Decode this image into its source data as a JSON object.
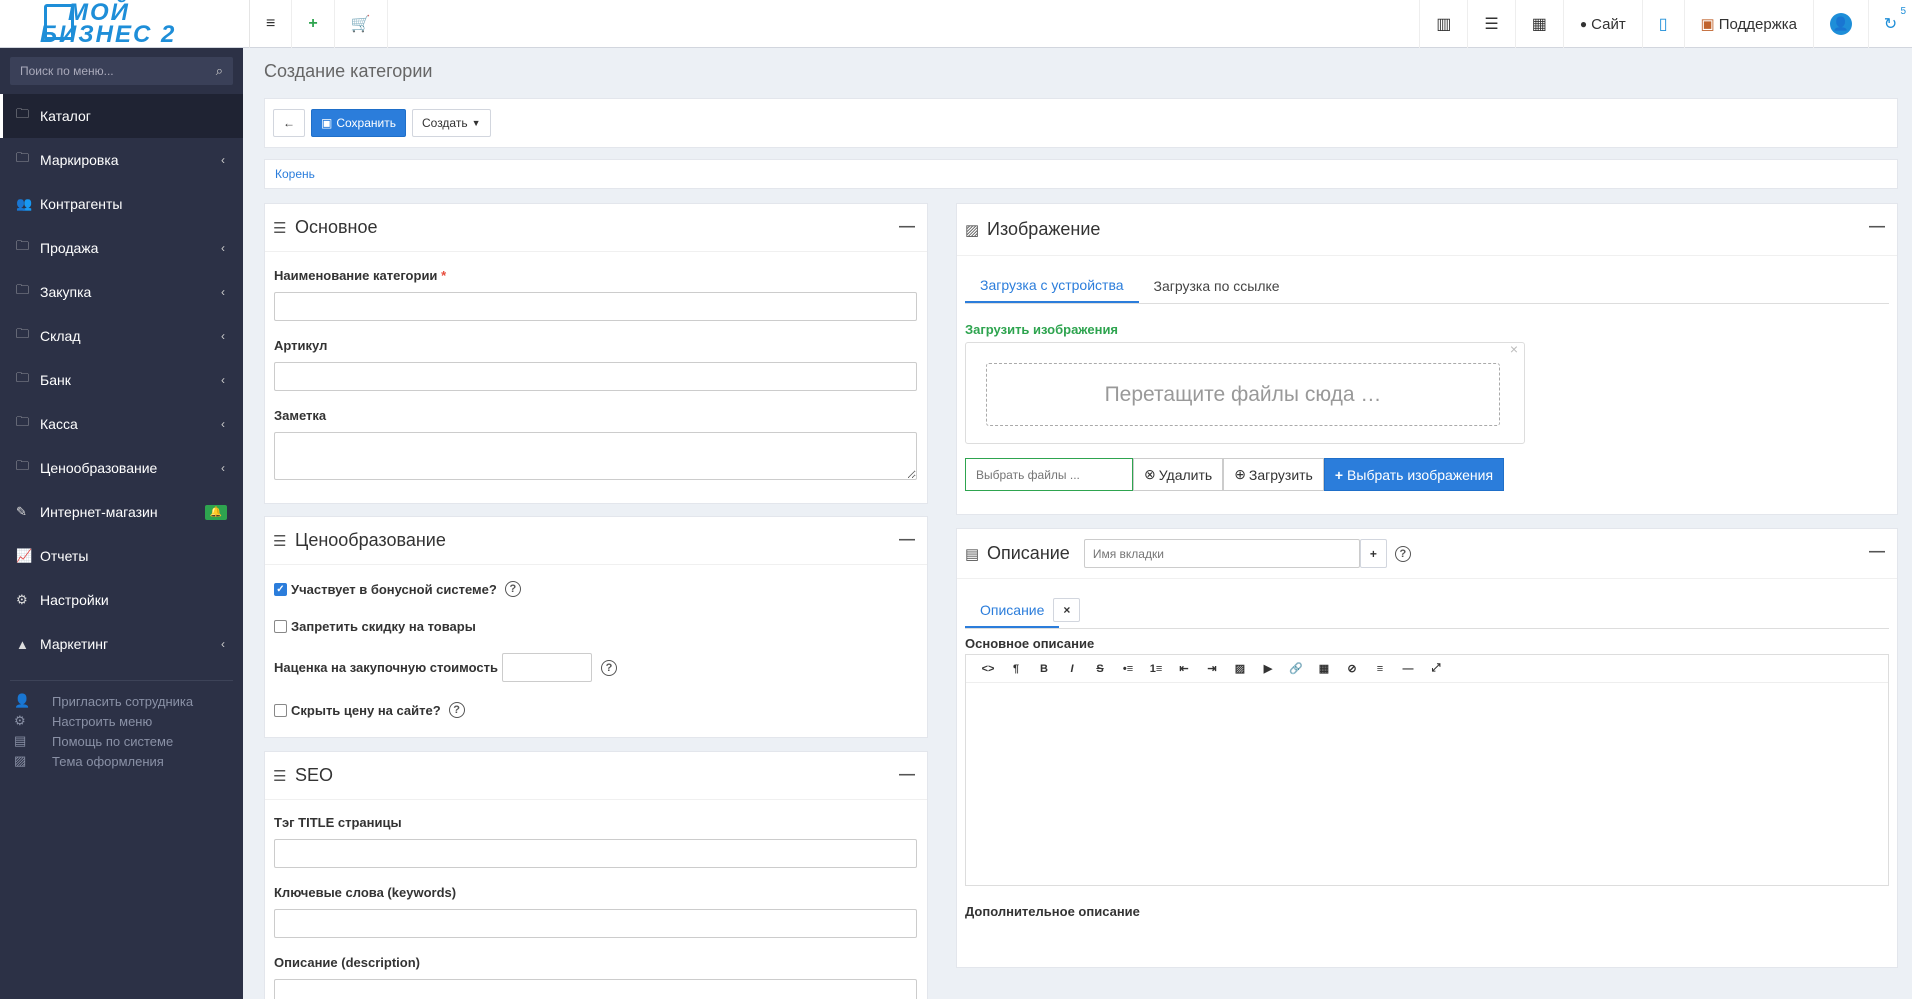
{
  "header": {
    "logo_line1": "МОЙ",
    "logo_line2": "БИЗНЕС 2",
    "site_label": "Сайт",
    "support_label": "Поддержка",
    "notif_count": "5"
  },
  "sidebar": {
    "search_placeholder": "Поиск по меню...",
    "items": [
      {
        "label": "Каталог"
      },
      {
        "label": "Маркировка"
      },
      {
        "label": "Контрагенты"
      },
      {
        "label": "Продажа"
      },
      {
        "label": "Закупка"
      },
      {
        "label": "Склад"
      },
      {
        "label": "Банк"
      },
      {
        "label": "Касса"
      },
      {
        "label": "Ценообразование"
      },
      {
        "label": "Интернет-магазин"
      },
      {
        "label": "Отчеты"
      },
      {
        "label": "Настройки"
      },
      {
        "label": "Маркетинг"
      }
    ],
    "extra": [
      {
        "label": "Пригласить сотрудника"
      },
      {
        "label": "Настроить меню"
      },
      {
        "label": "Помощь по системе"
      },
      {
        "label": "Тема оформления"
      }
    ]
  },
  "page": {
    "title": "Создание категории",
    "save_label": "Сохранить",
    "create_label": "Создать",
    "breadcrumb": "Корень"
  },
  "basic": {
    "title": "Основное",
    "name_label": "Наименование категории",
    "required_mark": "*",
    "article_label": "Артикул",
    "note_label": "Заметка"
  },
  "pricing": {
    "title": "Ценообразование",
    "bonus_label": "Участвует в бонусной системе?",
    "bonus_checked": true,
    "no_discount_label": "Запретить скидку на товары",
    "markup_label": "Наценка на закупочную стоимость",
    "hide_price_label": "Скрыть цену на сайте?"
  },
  "seo": {
    "title": "SEO",
    "title_tag_label": "Тэг TITLE страницы",
    "keywords_label": "Ключевые слова (keywords)",
    "description_label": "Описание (description)"
  },
  "image": {
    "title": "Изображение",
    "tab_device": "Загрузка с устройства",
    "tab_link": "Загрузка по ссылке",
    "upload_label": "Загрузить изображения",
    "drop_text": "Перетащите файлы сюда …",
    "choose_placeholder": "Выбрать файлы ...",
    "delete_label": "Удалить",
    "upload_btn": "Загрузить",
    "choose_images_btn": "Выбрать изображения"
  },
  "description": {
    "title": "Описание",
    "tab_name_placeholder": "Имя вкладки",
    "tab_label": "Описание",
    "main_desc_label": "Основное описание",
    "extra_desc_label": "Дополнительное описание"
  }
}
